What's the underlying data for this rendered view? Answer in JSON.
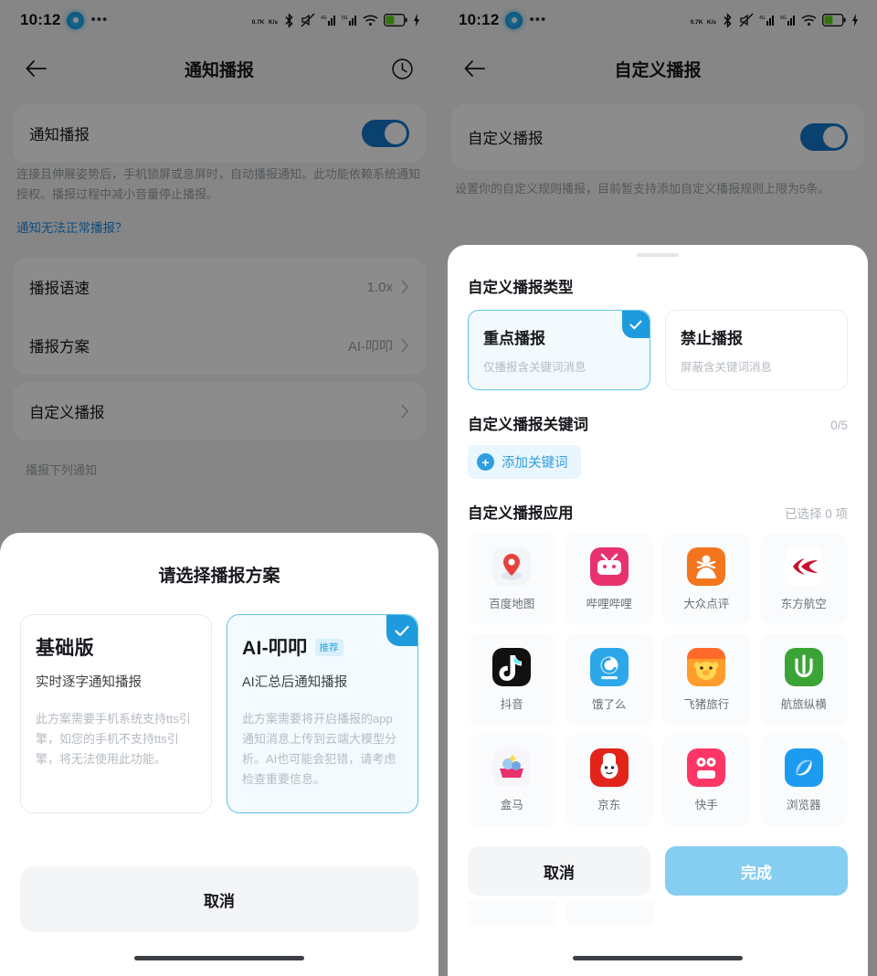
{
  "statusbar": {
    "time": "10:12",
    "net_speed_top": "0.7K",
    "net_speed_bottom": "K/s",
    "icons": [
      "network-speed",
      "bluetooth",
      "mute",
      "signal-1",
      "signal-2",
      "wifi",
      "battery-charging",
      "charging-bolt"
    ]
  },
  "left": {
    "appbar": {
      "title": "通知播报",
      "back_icon": "back-arrow-icon",
      "trailing_icon": "history-clock-icon"
    },
    "main_toggle": {
      "label": "通知播报",
      "state": "on"
    },
    "description": "连接且伸展姿势后，手机锁屏或息屏时，自动播报通知。此功能依赖系统通知授权。播报过程中减小音量停止播报。",
    "help_link": "通知无法正常播报？",
    "rows": [
      {
        "label": "播报语速",
        "value": "1.0x"
      },
      {
        "label": "播报方案",
        "value": "AI-叩叩"
      },
      {
        "label": "自定义播报",
        "value": ""
      }
    ],
    "section_label": "播报下列通知",
    "sheet": {
      "title": "请选择播报方案",
      "plans": [
        {
          "title": "基础版",
          "badge": "",
          "subtitle": "实时逐字通知播报",
          "body": "此方案需要手机系统支持tts引擎，如您的手机不支持tts引擎，将无法使用此功能。",
          "selected": false
        },
        {
          "title": "AI-叩叩",
          "badge": "推荐",
          "subtitle": "AI汇总后通知播报",
          "body": "此方案需要将开启播报的app通知消息上传到云端大模型分析。AI也可能会犯错，请考虑检查重要信息。",
          "selected": true
        }
      ],
      "cancel_label": "取消"
    }
  },
  "right": {
    "appbar": {
      "title": "自定义播报",
      "back_icon": "back-arrow-icon"
    },
    "main_toggle": {
      "label": "自定义播报",
      "state": "on"
    },
    "description": "设置你的自定义规则播报，目前暂支持添加自定义播报规则上限为5条。",
    "sheet": {
      "type_section": {
        "heading": "自定义播报类型"
      },
      "types": [
        {
          "title": "重点播报",
          "subtitle": "仅播报含关键词消息",
          "selected": true
        },
        {
          "title": "禁止播报",
          "subtitle": "屏蔽含关键词消息",
          "selected": false
        }
      ],
      "keyword_section": {
        "heading": "自定义播报关键词",
        "count": "0/5",
        "add_label": "添加关键词"
      },
      "apps_section": {
        "heading": "自定义播报应用",
        "selected_text": "已选择 0 项"
      },
      "apps": [
        {
          "name": "百度地图",
          "icon": "baidu-map-icon"
        },
        {
          "name": "哔哩哔哩",
          "icon": "bilibili-icon"
        },
        {
          "name": "大众点评",
          "icon": "dianping-icon"
        },
        {
          "name": "东方航空",
          "icon": "china-eastern-icon"
        },
        {
          "name": "抖音",
          "icon": "douyin-icon"
        },
        {
          "name": "饿了么",
          "icon": "eleme-icon"
        },
        {
          "name": "飞猪旅行",
          "icon": "fliggy-icon"
        },
        {
          "name": "航旅纵横",
          "icon": "umetrip-icon"
        },
        {
          "name": "盒马",
          "icon": "hema-icon"
        },
        {
          "name": "京东",
          "icon": "jd-icon"
        },
        {
          "name": "快手",
          "icon": "kuaishou-icon"
        },
        {
          "name": "浏览器",
          "icon": "browser-icon"
        }
      ],
      "cancel_label": "取消",
      "done_label": "完成"
    }
  },
  "colors": {
    "accent": "#1d9bdd",
    "toggle_on": "#1477c9",
    "primary_disabled": "#86cdf2",
    "selected_border": "#5ec2e8",
    "selected_bg": "#f3fafd"
  }
}
